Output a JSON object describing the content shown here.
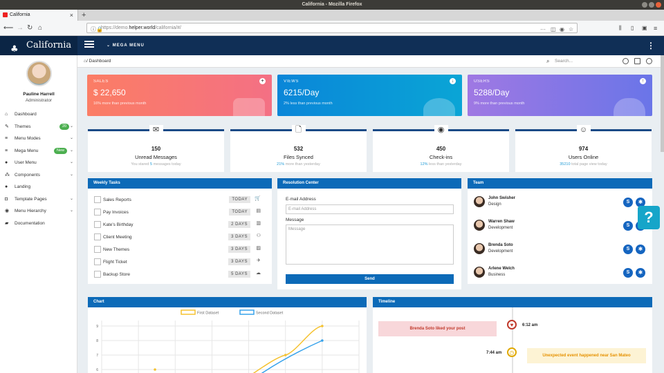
{
  "window": {
    "title": "California - Mozilla Firefox"
  },
  "browser": {
    "tab_title": "California",
    "url_prefix": "https://demo.",
    "url_host": "helper.world",
    "url_path": "/california/#/"
  },
  "app": {
    "brand": "California",
    "mega_menu": "MEGA MENU"
  },
  "user": {
    "name": "Pauline Harrell",
    "role": "Administrator"
  },
  "sidebar": {
    "items": [
      {
        "label": "Dashboard",
        "icon": "home-icon"
      },
      {
        "label": "Themes",
        "icon": "brush-icon",
        "badge": "20"
      },
      {
        "label": "Menu Modes",
        "icon": "bars-icon"
      },
      {
        "label": "Mega Menu",
        "icon": "bars-icon",
        "badge": "New"
      },
      {
        "label": "User Menu",
        "icon": "user-icon"
      },
      {
        "label": "Components",
        "icon": "sitemap-icon"
      },
      {
        "label": "Landing",
        "icon": "circle-icon"
      },
      {
        "label": "Template Pages",
        "icon": "file-icon"
      },
      {
        "label": "Menu Hierarchy",
        "icon": "eye-icon"
      },
      {
        "label": "Documentation",
        "icon": "book-icon"
      }
    ]
  },
  "breadcrumb": {
    "text": "/ Dashboard",
    "search_placeholder": "Search..."
  },
  "stats": [
    {
      "label": "SALES",
      "value": "$ 22,650",
      "sub": "16% more than previous month",
      "color": "#f9796b"
    },
    {
      "label": "VIEWS",
      "value": "6215/Day",
      "sub": "2% less than previous month",
      "color": "#0c8fd6"
    },
    {
      "label": "USERS",
      "value": "5288/Day",
      "sub": "9% more than previous month",
      "color": "#8a6fe6"
    }
  ],
  "mini_stats": [
    {
      "icon": "envelope-icon",
      "number": "150",
      "title": "Unread Messages",
      "cap_pre": "You stared ",
      "cap_hl": "5",
      "cap_post": " messages today"
    },
    {
      "icon": "file-icon",
      "number": "532",
      "title": "Files Synced",
      "cap_pre": "",
      "cap_hl": "21%",
      "cap_post": " more than yesterday"
    },
    {
      "icon": "map-pin-icon",
      "number": "450",
      "title": "Check-ins",
      "cap_pre": "",
      "cap_hl": "12%",
      "cap_post": " less than yesterday"
    },
    {
      "icon": "user-circle-icon",
      "number": "974",
      "title": "Users Online",
      "cap_pre": "",
      "cap_hl": "35210",
      "cap_post": " total page view today"
    }
  ],
  "weekly_tasks": {
    "title": "Weekly Tasks",
    "items": [
      {
        "name": "Sales Reports",
        "tag": "TODAY",
        "icon": "cart-icon"
      },
      {
        "name": "Pay Invoices",
        "tag": "TODAY",
        "icon": "file-icon"
      },
      {
        "name": "Kate's Birthday",
        "tag": "2 DAYS",
        "icon": "cake-icon"
      },
      {
        "name": "Client Meeting",
        "tag": "3 DAYS",
        "icon": "users-icon"
      },
      {
        "name": "New Themes",
        "tag": "3 DAYS",
        "icon": "image-icon"
      },
      {
        "name": "Flight Ticket",
        "tag": "3 DAYS",
        "icon": "plane-icon"
      },
      {
        "name": "Backup Store",
        "tag": "5 DAYS",
        "icon": "cloud-icon"
      }
    ]
  },
  "resolution": {
    "title": "Resolution Center",
    "email_label": "E-mail Address",
    "email_placeholder": "E-mail Address",
    "message_label": "Message",
    "message_placeholder": "Message",
    "send": "Send"
  },
  "team": {
    "title": "Team",
    "members": [
      {
        "name": "John Swisher",
        "role": "Design"
      },
      {
        "name": "Warren Shaw",
        "role": "Development"
      },
      {
        "name": "Brenda Soto",
        "role": "Development"
      },
      {
        "name": "Arlene Welch",
        "role": "Business"
      }
    ]
  },
  "chart": {
    "title": "Chart"
  },
  "chart_data": {
    "type": "line",
    "title": "",
    "legend_position": "top",
    "grid": true,
    "series": [
      {
        "name": "First Dataset",
        "color": "#f5c230",
        "x": [
          5,
          6
        ],
        "y": [
          7,
          9
        ]
      },
      {
        "name": "Second Dataset",
        "color": "#36a2eb",
        "x": [
          6
        ],
        "y": [
          8
        ]
      }
    ],
    "y_ticks": [
      "9",
      "8",
      "7",
      "6"
    ]
  },
  "timeline": {
    "title": "Timeline",
    "events": [
      {
        "text": "Brenda Soto liked your post",
        "time": "6:12 am",
        "icon": "heart-icon"
      },
      {
        "text": "Unexpected event happened near San Mateo",
        "time": "7:44 am",
        "icon": "clock-icon"
      }
    ]
  }
}
